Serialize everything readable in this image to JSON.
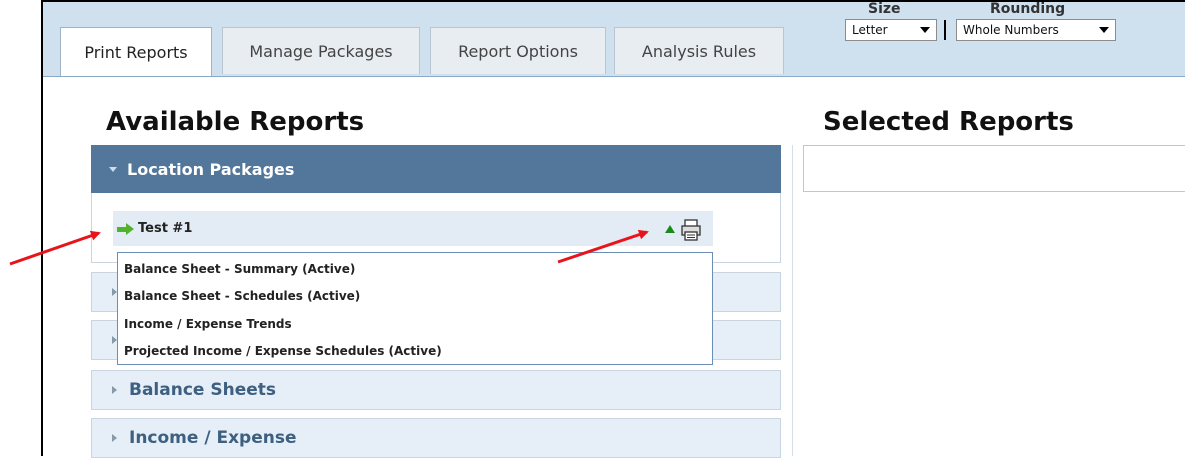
{
  "tabs": [
    {
      "label": "Print Reports",
      "active": true
    },
    {
      "label": "Manage Packages",
      "active": false
    },
    {
      "label": "Report Options",
      "active": false
    },
    {
      "label": "Analysis Rules",
      "active": false
    }
  ],
  "size": {
    "label": "Size",
    "value": "Letter"
  },
  "rounding": {
    "label": "Rounding",
    "value": "Whole Numbers"
  },
  "available": {
    "heading": "Available Reports",
    "package_group": "Location Packages",
    "package_name": "Test #1",
    "dropdown_items": [
      "Balance Sheet - Summary (Active)",
      "Balance Sheet - Schedules (Active)",
      "Income / Expense Trends",
      "Projected Income / Expense Schedules (Active)"
    ],
    "categories": [
      "",
      "",
      "Balance Sheets",
      "Income / Expense"
    ]
  },
  "selected": {
    "heading": "Selected Reports"
  },
  "colors": {
    "header_bg": "#53779a",
    "tab_bar": "#cfe0ef",
    "annotation": "#e8141c",
    "accent_green": "#52b32a"
  }
}
